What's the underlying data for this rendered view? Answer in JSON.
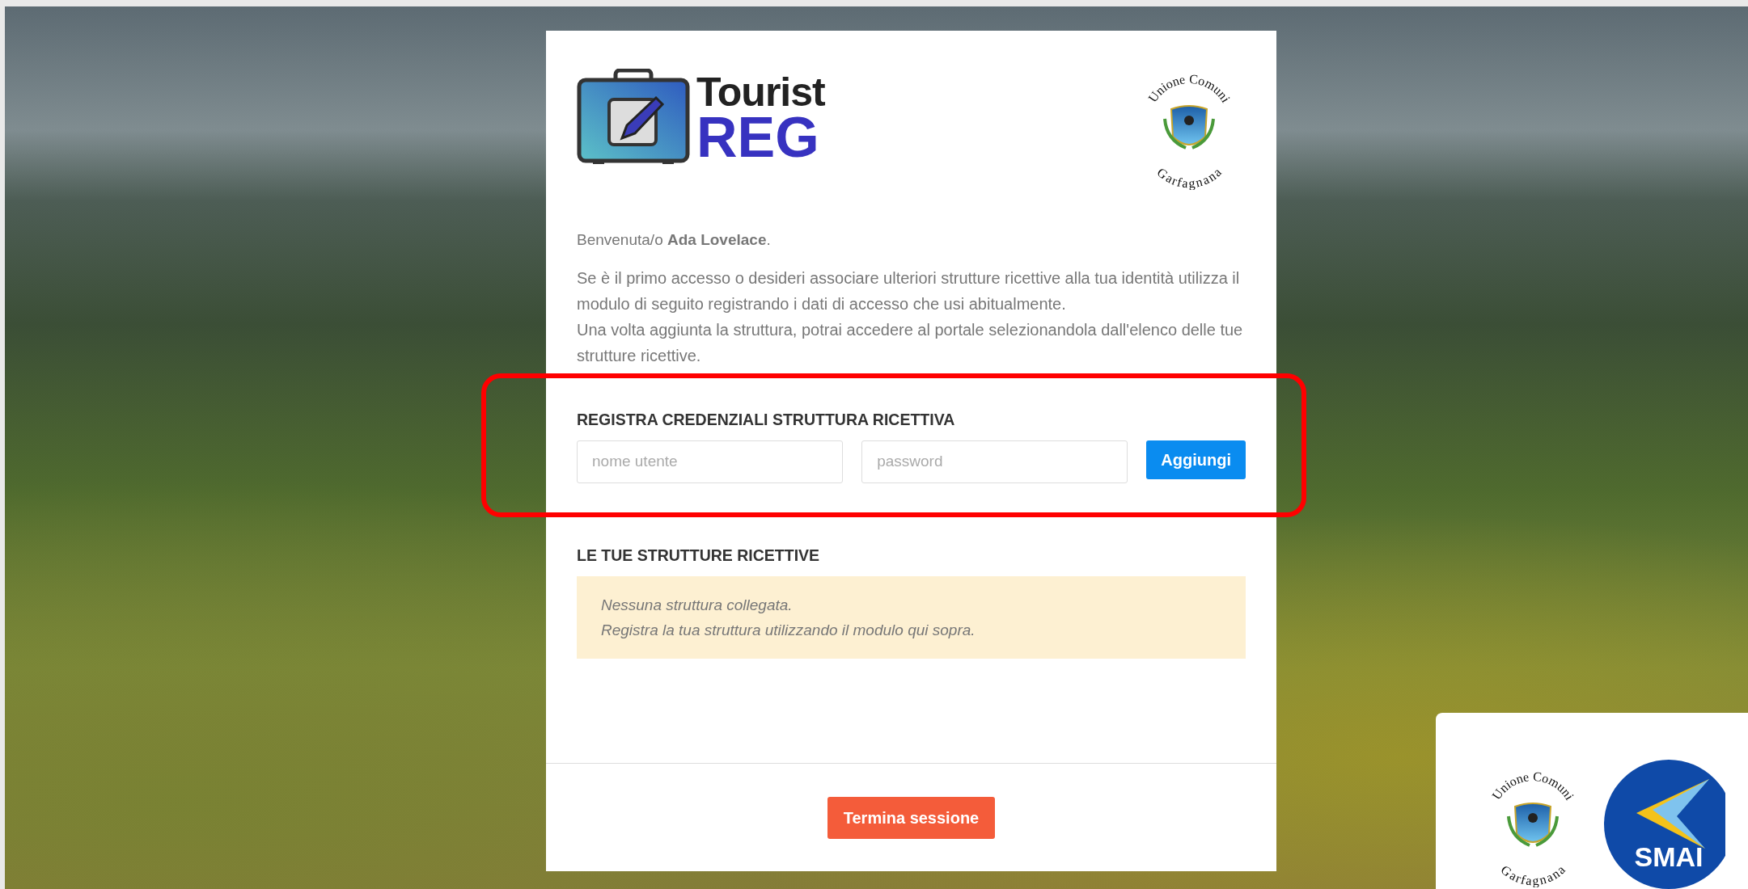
{
  "header": {
    "logo": {
      "line_1": "Tourist",
      "line_2": "REG"
    },
    "emblem": {
      "top": "Unione Comuni",
      "bottom": "Garfagnana"
    }
  },
  "welcome": "Benvenuta/o **Ada Lovelace**.",
  "intro": [
    "Se è il primo accesso o desideri associare ulteriori strutture ricettive alla tua identità utilizza il modulo di seguito registrando i dati di accesso che usi abitualmente.",
    "Una volta aggiunta la struttura, potrai accedere al portale selezionandola dall'elenco delle tue strutture ricettive."
  ],
  "register": {
    "title": "REGISTRA CREDENZIALI STRUTTURA RICETTIVA",
    "highlighted": true,
    "fields": [
      {
        "placeholder": "nome utente"
      },
      {
        "placeholder": "password"
      }
    ],
    "button": "Aggiungi"
  },
  "structures": {
    "title": "LE TUE STRUTTURE RICETTIVE",
    "empty_message": [
      "Nessuna struttura collegata.",
      "Registra la tua struttura utilizzando il modulo qui sopra."
    ]
  },
  "logout_button": "Termina sessione",
  "partner_logos": {
    "emblem": {
      "top": "Unione Comuni",
      "bottom": "Garfagnana"
    },
    "smai": "SMAI"
  }
}
